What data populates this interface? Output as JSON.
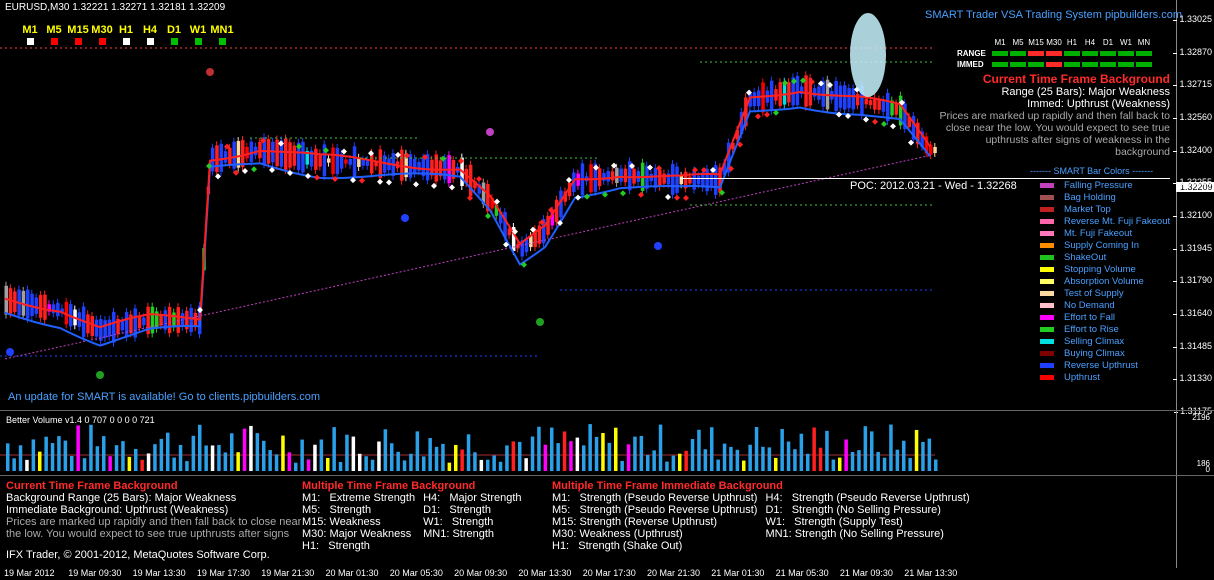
{
  "header": {
    "symbol": "EURUSD,M30  1.32221 1.32271 1.32181 1.32209",
    "site": "SMART Trader VSA Trading System pipbuilders.com"
  },
  "timeframes": [
    {
      "label": "M1",
      "color": "#ffffff"
    },
    {
      "label": "M5",
      "color": "#ff0000"
    },
    {
      "label": "M15",
      "color": "#ff0000"
    },
    {
      "label": "M30",
      "color": "#ff0000"
    },
    {
      "label": "H1",
      "color": "#ffffff"
    },
    {
      "label": "H4",
      "color": "#ffffff"
    },
    {
      "label": "D1",
      "color": "#00c000"
    },
    {
      "label": "W1",
      "color": "#00c000"
    },
    {
      "label": "MN1",
      "color": "#00c000"
    }
  ],
  "mini_table": {
    "headers": [
      "M1",
      "M5",
      "M15",
      "M30",
      "H1",
      "H4",
      "D1",
      "W1",
      "MN"
    ],
    "range_label": "RANGE",
    "immed_label": "IMMED",
    "range_colors": [
      "#00b000",
      "#00b000",
      "#ff2a2a",
      "#ff2a2a",
      "#00b000",
      "#00b000",
      "#00b000",
      "#00b000",
      "#00b000"
    ],
    "immed_colors": [
      "#00b000",
      "#00b000",
      "#00b000",
      "#ff2a2a",
      "#00b000",
      "#00b000",
      "#00b000",
      "#00b000",
      "#00b000"
    ]
  },
  "background": {
    "title": "Current Time Frame Background",
    "range": "Range (25 Bars): Major Weakness",
    "immed": "Immed: Upthrust (Weakness)",
    "description": "Prices are marked up rapidly and then fall back to close near the low. You would expect to see true upthrusts after signs of weakness in the background"
  },
  "legend": {
    "title": "------- SMART Bar Colors -------",
    "items": [
      {
        "label": "Falling Pressure",
        "color": "#c040c0"
      },
      {
        "label": "Bag Holding",
        "color": "#a05050"
      },
      {
        "label": "Market Top",
        "color": "#c02020"
      },
      {
        "label": "Reverse Mt. Fuji Fakeout",
        "color": "#ff66aa"
      },
      {
        "label": "Mt. Fuji Fakeout",
        "color": "#ff77bb"
      },
      {
        "label": "Supply Coming In",
        "color": "#ff8c00"
      },
      {
        "label": "ShakeOut",
        "color": "#20c020"
      },
      {
        "label": "Stopping Volume",
        "color": "#ffff00"
      },
      {
        "label": "Absorption Volume",
        "color": "#ffff66"
      },
      {
        "label": "Test of Supply",
        "color": "#ffd9a0"
      },
      {
        "label": "No Demand",
        "color": "#ffc0cb"
      },
      {
        "label": "Effort to Fall",
        "color": "#ff00ff"
      },
      {
        "label": "Effort to Rise",
        "color": "#22cc22"
      },
      {
        "label": "Selling Climax",
        "color": "#00e0e0"
      },
      {
        "label": "Buying Climax",
        "color": "#800000"
      },
      {
        "label": "Reverse Upthrust",
        "color": "#2040ff"
      },
      {
        "label": "Upthrust",
        "color": "#ff0000"
      }
    ]
  },
  "poc": "POC: 2012.03.21 - Wed - 1.32268",
  "update_message": "An update for SMART is available! Go to clients.pipbuilders.com",
  "price_axis": [
    "1.33025",
    "1.32870",
    "1.32715",
    "1.32560",
    "1.32400",
    "1.32255",
    "1.32100",
    "1.31945",
    "1.31790",
    "1.31640",
    "1.31485",
    "1.31330",
    "1.31175"
  ],
  "current_price": "1.32209",
  "volume": {
    "label": "Better Volume v1.4 0 707 0 0 0 0 721",
    "top_tick": "2196",
    "bottom_tick": "186",
    "bottom_tick2": "0"
  },
  "info": {
    "col1": {
      "title": "Current Time Frame Background",
      "lines": [
        "Background Range (25 Bars): Major Weakness",
        "Immediate Background: Upthrust (Weakness)"
      ],
      "desc": "Prices are marked up rapidly and then fall back to close near\nthe low. You would expect to see true upthrusts after signs\nof weakness in the background"
    },
    "col2": {
      "title": "Multiple Time Frame Background",
      "left": "M1:   Extreme Strength\nM5:   Strength\nM15: Weakness\nM30: Major Weakness\nH1:   Strength",
      "right": "H4:   Major Strength\nD1:   Strength\nW1:   Strength\nMN1: Strength"
    },
    "col3": {
      "title": "Multiple Time Frame Immediate Background",
      "left": "M1:   Strength (Pseudo Reverse Upthrust)\nM5:   Strength (Pseudo Reverse Upthrust)\nM15: Strength (Reverse Upthrust)\nM30: Weakness (Upthrust)\nH1:   Strength (Shake Out)",
      "right": "H4:   Strength (Pseudo Reverse Upthrust)\nD1:   Strength (No Selling Pressure)\nW1:   Strength (Supply Test)\nMN1: Strength (No Selling Pressure)"
    },
    "copyright": "IFX Trader, © 2001-2012, MetaQuotes Software Corp."
  },
  "time_axis": [
    "19 Mar 2012",
    "19 Mar 09:30",
    "19 Mar 13:30",
    "19 Mar 17:30",
    "19 Mar 21:30",
    "20 Mar 01:30",
    "20 Mar 05:30",
    "20 Mar 09:30",
    "20 Mar 13:30",
    "20 Mar 17:30",
    "20 Mar 21:30",
    "21 Mar 01:30",
    "21 Mar 05:30",
    "21 Mar 09:30",
    "21 Mar 13:30"
  ]
}
